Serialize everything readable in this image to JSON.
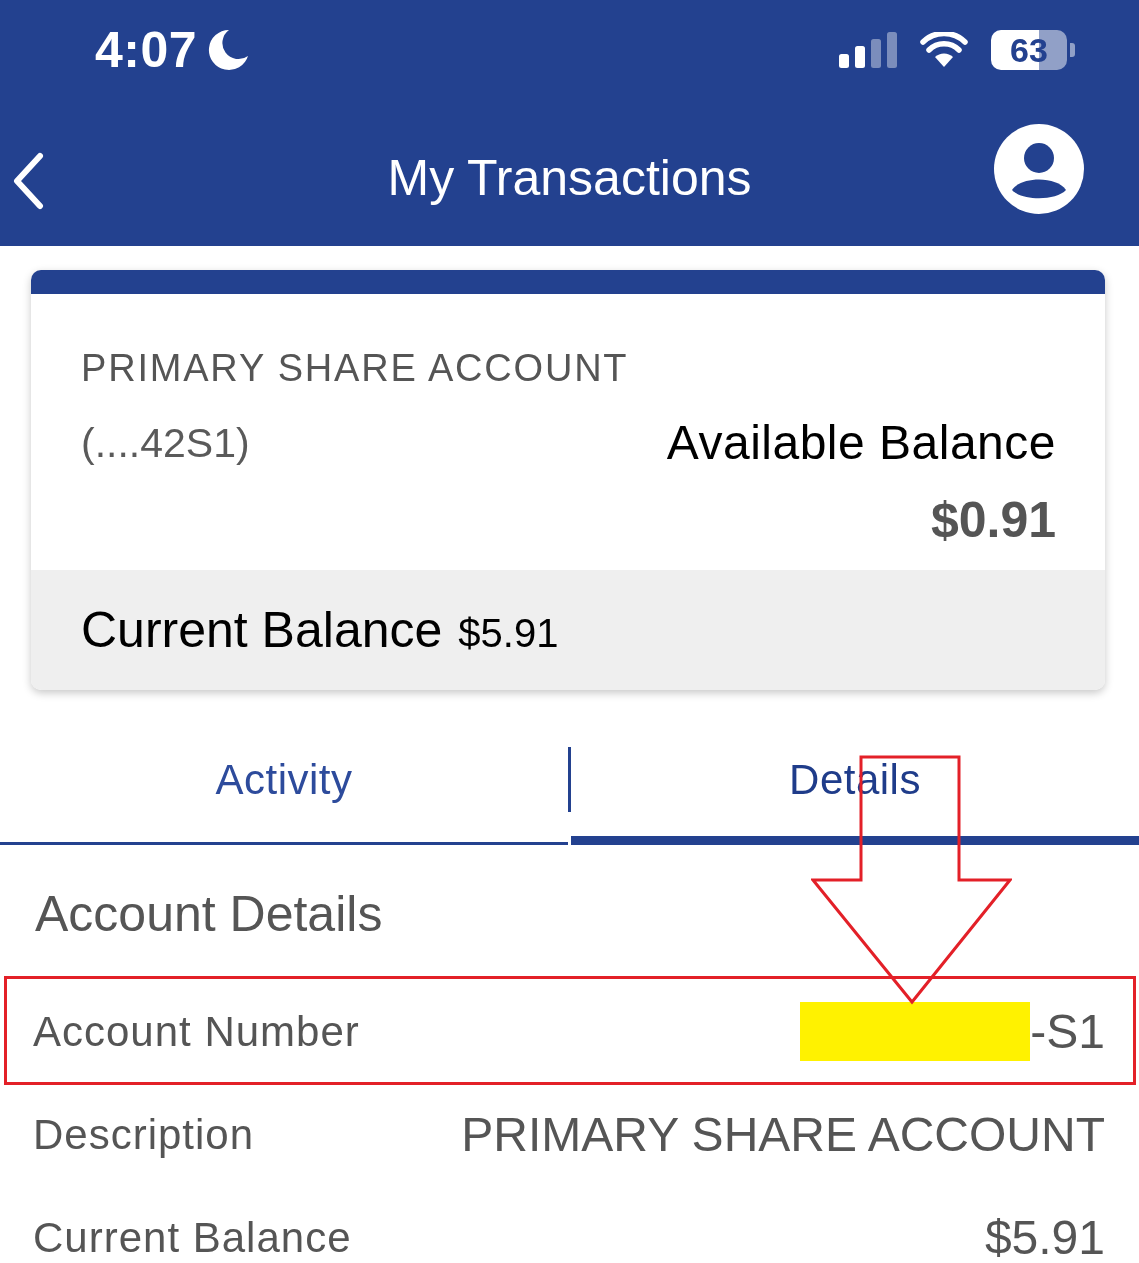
{
  "status_bar": {
    "time": "4:07",
    "battery": "63"
  },
  "header": {
    "title": "My Transactions"
  },
  "account_card": {
    "name": "PRIMARY SHARE ACCOUNT",
    "number": "(....42S1)",
    "available_label": "Available Balance",
    "available_amount": "$0.91",
    "current_label": "Current Balance",
    "current_amount": "$5.91"
  },
  "tabs": [
    {
      "label": "Activity",
      "selected": false
    },
    {
      "label": "Details",
      "selected": true
    }
  ],
  "details": {
    "title": "Account Details",
    "rows": [
      {
        "label": "Account Number",
        "value": "-S1",
        "redacted": true,
        "highlighted": true
      },
      {
        "label": "Description",
        "value": "PRIMARY SHARE ACCOUNT",
        "redacted": false,
        "highlighted": false
      },
      {
        "label": "Current Balance",
        "value": "$5.91",
        "redacted": false,
        "highlighted": false
      }
    ]
  },
  "annotations": [
    {
      "kind": "arrow"
    }
  ]
}
